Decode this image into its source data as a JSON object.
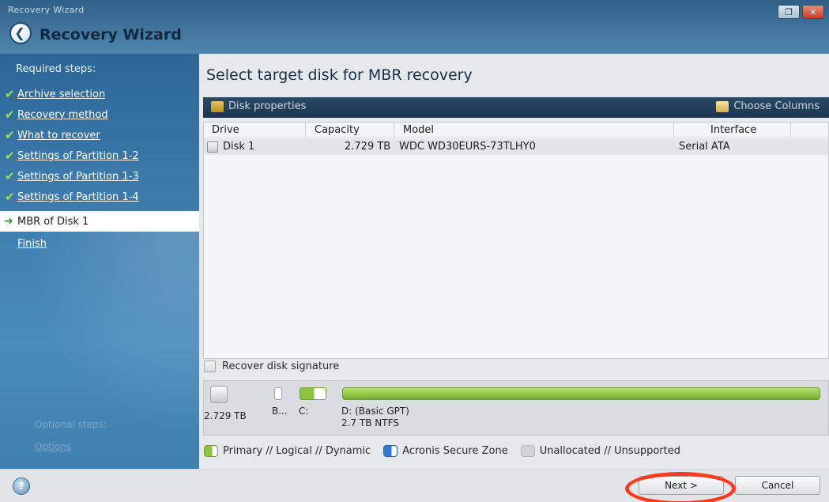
{
  "window": {
    "caption": "Recovery Wizard",
    "title": "Recovery Wizard",
    "app_icon": "back-arrow-icon",
    "restore_label": "❐",
    "close_label": "✕"
  },
  "sidebar": {
    "heading": "Required steps:",
    "steps": [
      {
        "label": "Archive selection"
      },
      {
        "label": "Recovery method"
      },
      {
        "label": "What to recover"
      },
      {
        "label": "Settings of Partition 1-2"
      },
      {
        "label": "Settings of Partition 1-3"
      },
      {
        "label": "Settings of Partition 1-4"
      },
      {
        "label": "MBR of Disk 1"
      },
      {
        "label": "Finish"
      }
    ],
    "optional_heading": "Optional steps:",
    "optional_link": "Options"
  },
  "main": {
    "title": "Select target disk for MBR recovery",
    "toolbar": {
      "disk_properties": "Disk properties",
      "choose_columns": "Choose Columns"
    },
    "grid": {
      "columns": [
        "Drive",
        "Capacity",
        "Model",
        "Interface"
      ],
      "rows": [
        {
          "drive": "Disk 1",
          "capacity": "2.729 TB",
          "model": "WDC WD30EURS-73TLHY0",
          "interface": "Serial ATA"
        }
      ]
    },
    "recover_signature_label": "Recover disk signature",
    "diskmap": {
      "size": "2.729 TB",
      "part_b": "B...",
      "part_c": "C:",
      "part_d_name": "D: (Basic GPT)",
      "part_d_detail": "2.7 TB  NTFS"
    },
    "legend": {
      "primary": "Primary // Logical // Dynamic",
      "secure_zone": "Acronis Secure Zone",
      "unallocated": "Unallocated // Unsupported"
    }
  },
  "buttons": {
    "next": "Next >",
    "cancel": "Cancel"
  },
  "colors": {
    "accent_green": "#8cc63f",
    "sidebar_blue": "#3a79aa",
    "highlight_red": "#ff3a1f"
  }
}
